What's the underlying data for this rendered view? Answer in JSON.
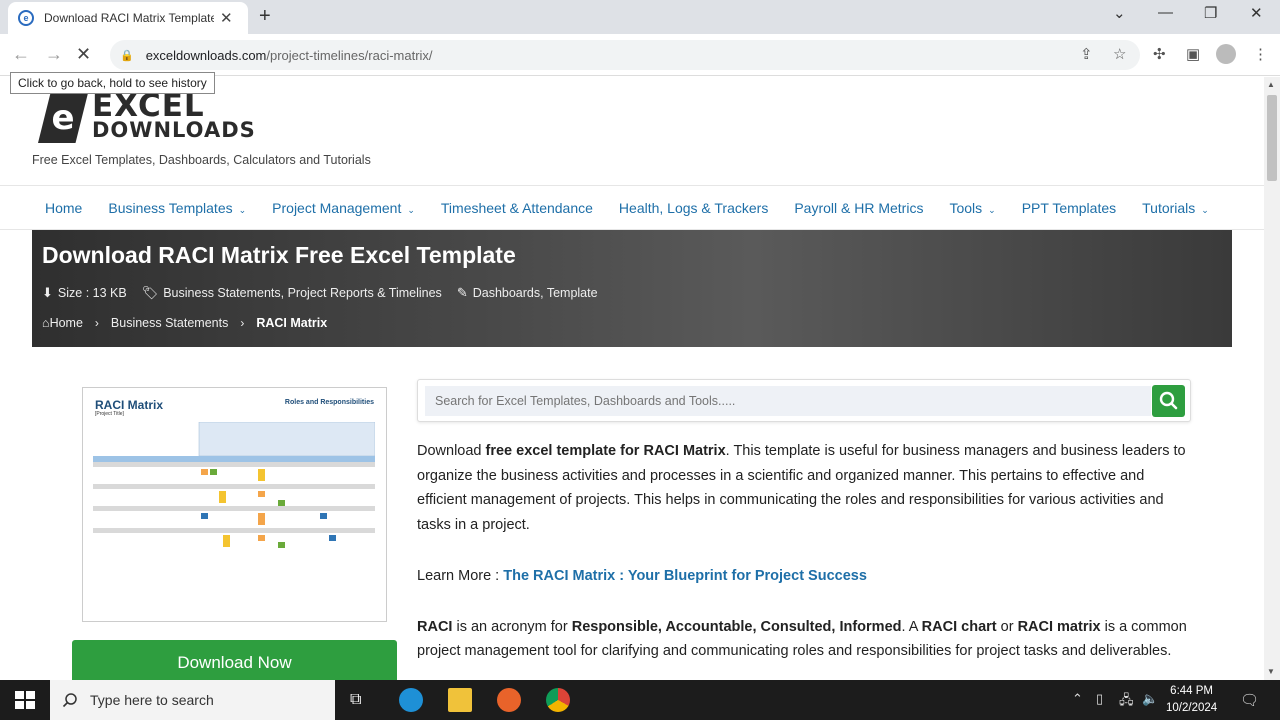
{
  "browser": {
    "tab_title": "Download RACI Matrix Template",
    "tab_close": "✕",
    "new_tab": "+",
    "url_domain": "exceldownloads.com",
    "url_path": "/project-timelines/raci-matrix/",
    "back_tooltip": "Click to go back, hold to see history"
  },
  "site": {
    "logo_line1": "EXCEL",
    "logo_line2": "DOWNLOADS",
    "logo_mark": "e",
    "tagline": "Free Excel Templates, Dashboards, Calculators and Tutorials"
  },
  "nav": {
    "items": [
      {
        "label": "Home",
        "dropdown": false
      },
      {
        "label": "Business Templates",
        "dropdown": true
      },
      {
        "label": "Project Management",
        "dropdown": true
      },
      {
        "label": "Timesheet & Attendance",
        "dropdown": false
      },
      {
        "label": "Health, Logs & Trackers",
        "dropdown": false
      },
      {
        "label": "Payroll & HR Metrics",
        "dropdown": false
      },
      {
        "label": "Tools",
        "dropdown": true
      },
      {
        "label": "PPT Templates",
        "dropdown": false
      },
      {
        "label": "Tutorials",
        "dropdown": true
      }
    ]
  },
  "hero": {
    "title": "Download RACI Matrix Free Excel Template",
    "size": "Size : 13 KB",
    "categories": "Business Statements, Project Reports & Timelines",
    "tags": "Dashboards, Template",
    "breadcrumb": [
      "Home",
      "Business Statements",
      "RACI Matrix"
    ]
  },
  "preview": {
    "title": "RACI Matrix",
    "subtitle": "[Project Title]",
    "right_title": "Roles and Responsibilities"
  },
  "download_button": "Download Now",
  "search": {
    "placeholder": "Search for Excel Templates, Dashboards and Tools....."
  },
  "article": {
    "p1_a": "Download ",
    "p1_b": "free excel template for RACI Matrix",
    "p1_c": ". This template is useful for business managers and business leaders to organize the business activities and processes in a scientific and organized manner. This pertains to effective and efficient management of projects. This helps in communicating the roles and responsibilities for various activities and tasks in a project.",
    "learn_prefix": "Learn More : ",
    "learn_link": "The RACI Matrix : Your Blueprint for Project Success",
    "p3_a": "RACI",
    "p3_b": " is an acronym for ",
    "p3_c": "Responsible, Accountable, Consulted, Informed",
    "p3_d": ". A ",
    "p3_e": "RACI chart",
    "p3_f": " or ",
    "p3_g": "RACI matrix",
    "p3_h": " is a common project management tool for clarifying and communicating roles and responsibilities for project tasks and deliverables."
  },
  "taskbar": {
    "search_text": "Type here to search",
    "time": "6:44 PM",
    "date": "10/2/2024"
  },
  "colors": {
    "accent_green": "#2e9e3f",
    "link_blue": "#1e6fa8"
  }
}
